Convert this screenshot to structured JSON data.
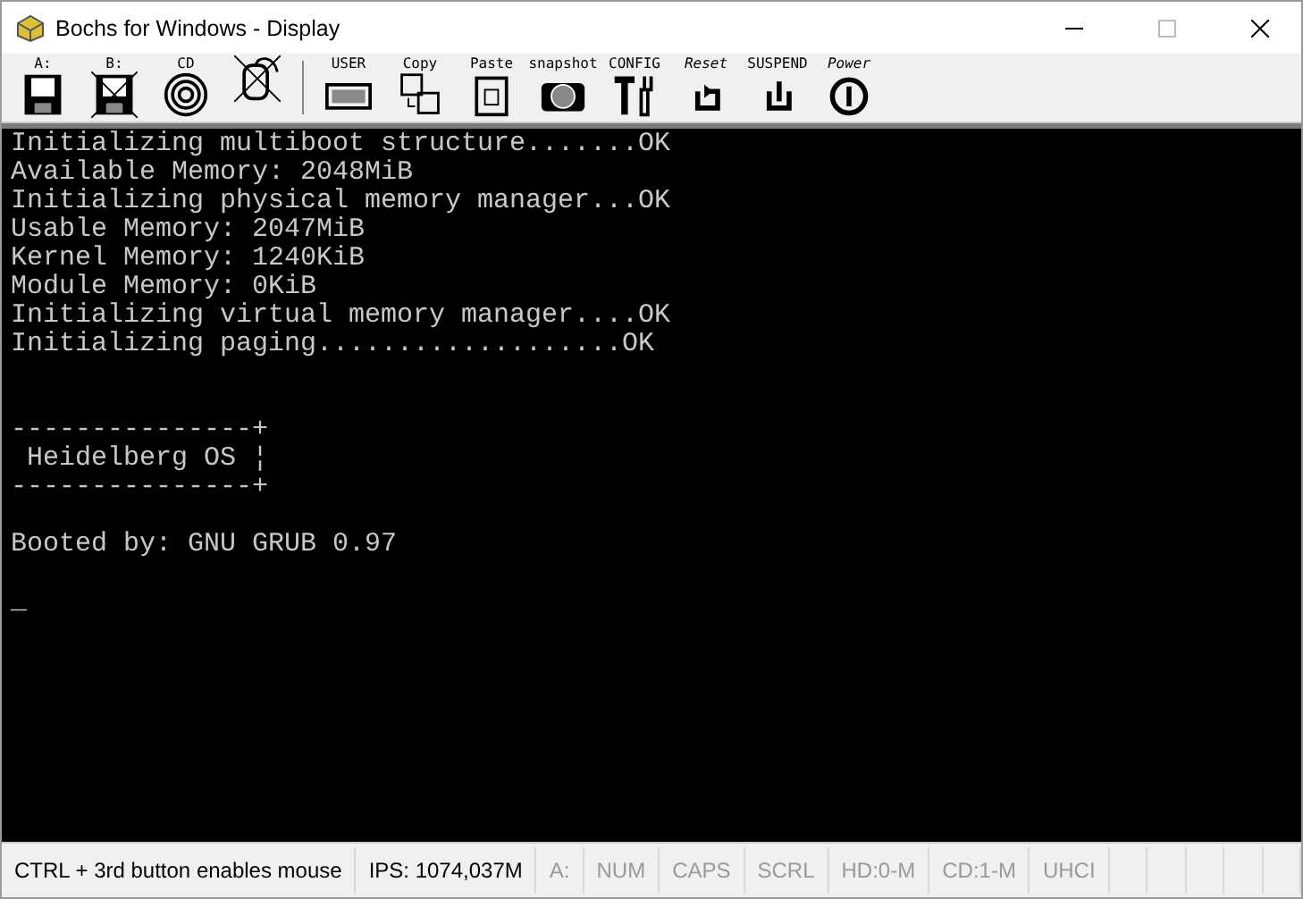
{
  "window": {
    "title": "Bochs for Windows - Display"
  },
  "toolbar": [
    {
      "kind": "floppy",
      "label": "A:",
      "crossed": false
    },
    {
      "kind": "floppy",
      "label": "B:",
      "crossed": true
    },
    {
      "kind": "cdrom",
      "label": "CD",
      "crossed": false
    },
    {
      "kind": "mouse",
      "crossed": true
    },
    {
      "kind": "keyboard",
      "label": "USER",
      "crossed": false
    },
    {
      "kind": "copy",
      "label": "Copy",
      "crossed": false
    },
    {
      "kind": "paste",
      "label": "Paste",
      "crossed": false
    },
    {
      "kind": "camera",
      "label": "snapshot",
      "crossed": false
    },
    {
      "kind": "config",
      "label": "CONFIG",
      "crossed": false
    },
    {
      "kind": "reset",
      "label": "Reset",
      "crossed": false
    },
    {
      "kind": "suspend",
      "label": "SUSPEND",
      "crossed": false
    },
    {
      "kind": "power",
      "label": "Power",
      "crossed": false
    }
  ],
  "console": {
    "blocks": [
      [
        "Initializing multiboot structure.......OK",
        "Available Memory: 2048MiB",
        "Initializing physical memory manager...OK",
        "Usable Memory: 2047MiB",
        "Kernel Memory: 1240KiB",
        "Module Memory: 0KiB",
        "Initializing virtual memory manager....OK",
        "Initializing paging...................OK"
      ],
      [
        "---------------+",
        " Heidelberg OS ¦",
        "---------------+"
      ],
      [
        "Booted by: GNU GRUB 0.97"
      ]
    ],
    "cursor": "_"
  },
  "status_bar": [
    {
      "text": "CTRL + 3rd button enables mouse",
      "disabled": false
    },
    {
      "text": "IPS: 1074,037M",
      "disabled": false
    },
    {
      "text": "A:",
      "disabled": true
    },
    {
      "text": "NUM",
      "disabled": true
    },
    {
      "text": "CAPS",
      "disabled": true
    },
    {
      "text": "SCRL",
      "disabled": true
    },
    {
      "text": "HD:0-M",
      "disabled": true
    },
    {
      "text": "CD:1-M",
      "disabled": true
    },
    {
      "text": "UHCI",
      "disabled": true
    }
  ]
}
